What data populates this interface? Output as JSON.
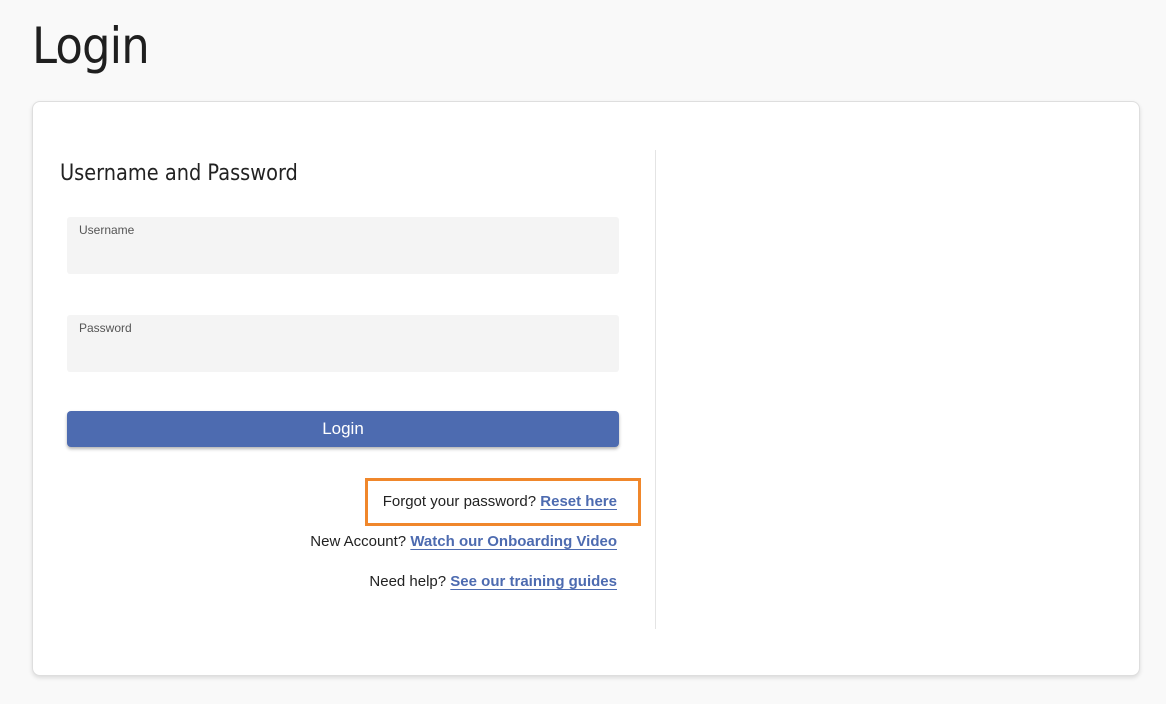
{
  "page": {
    "title": "Login"
  },
  "form": {
    "section_title": "Username and Password",
    "username": {
      "label": "Username",
      "value": ""
    },
    "password": {
      "label": "Password",
      "value": ""
    },
    "submit_label": "Login"
  },
  "links": {
    "forgot": {
      "prompt": "Forgot your password?",
      "link_text": "Reset here"
    },
    "new_account": {
      "prompt": "New Account?",
      "link_text": "Watch our Onboarding Video"
    },
    "help": {
      "prompt": "Need help?",
      "link_text": "See our training guides"
    }
  },
  "colors": {
    "accent": "#4d6bb0",
    "highlight": "#f0872b",
    "field_background": "#f4f4f4",
    "page_background": "#f9f9f9"
  }
}
